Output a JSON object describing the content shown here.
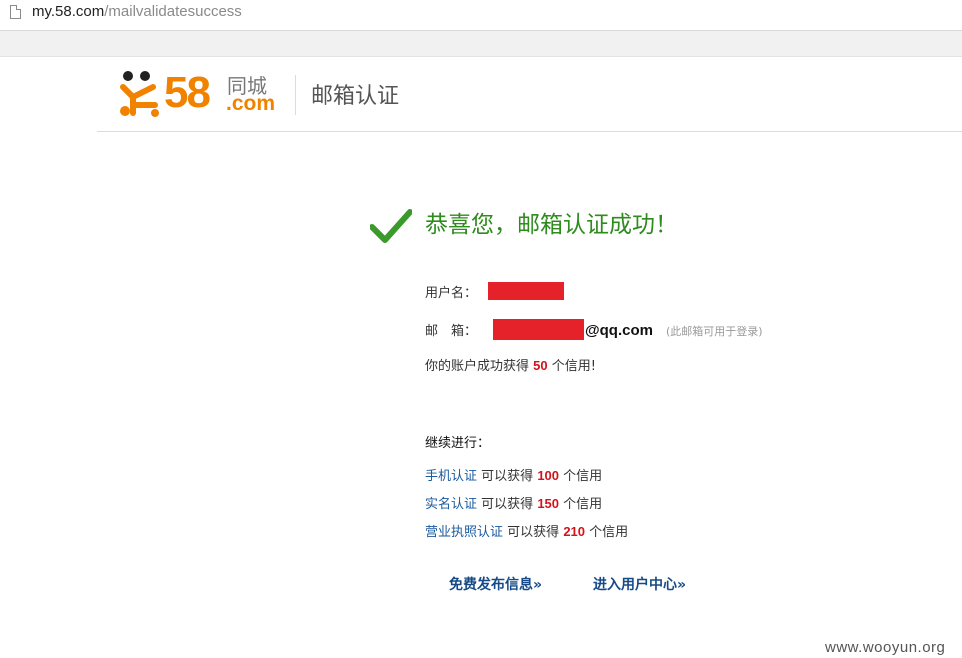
{
  "browser": {
    "url_host": "my.58.com",
    "url_path": "/mailvalidatesuccess"
  },
  "header": {
    "logo_number": "58",
    "logo_chinese": "同城",
    "logo_com": ".com",
    "title": "邮箱认证"
  },
  "success": {
    "title": "恭喜您，邮箱认证成功！"
  },
  "account": {
    "username_label": "用户名：",
    "email_label": "邮　箱：",
    "email_domain": "@qq.com",
    "email_note": "(此邮箱可用于登录)",
    "credit_prefix": "你的账户成功获得",
    "credit_value": "50",
    "credit_suffix": "个信用!"
  },
  "continue": {
    "heading": "继续进行：",
    "items": [
      {
        "link": "手机认证",
        "prefix": "可以获得",
        "value": "100",
        "suffix": "个信用"
      },
      {
        "link": "实名认证",
        "prefix": "可以获得",
        "value": "150",
        "suffix": "个信用"
      },
      {
        "link": "营业执照认证",
        "prefix": "可以获得",
        "value": "210",
        "suffix": "个信用"
      }
    ]
  },
  "actions": {
    "publish": "免费发布信息»",
    "user_center": "进入用户中心»"
  },
  "watermark": "www.wooyun.org",
  "colors": {
    "brand_orange": "#f08200",
    "success_green": "#2e8b1d",
    "highlight_red": "#d3121a",
    "link_blue": "#1a5a9e",
    "redaction_red": "#e5222a"
  },
  "icons": {
    "page": "page-icon",
    "mascot": "58-mascot-icon",
    "check": "checkmark-icon"
  }
}
